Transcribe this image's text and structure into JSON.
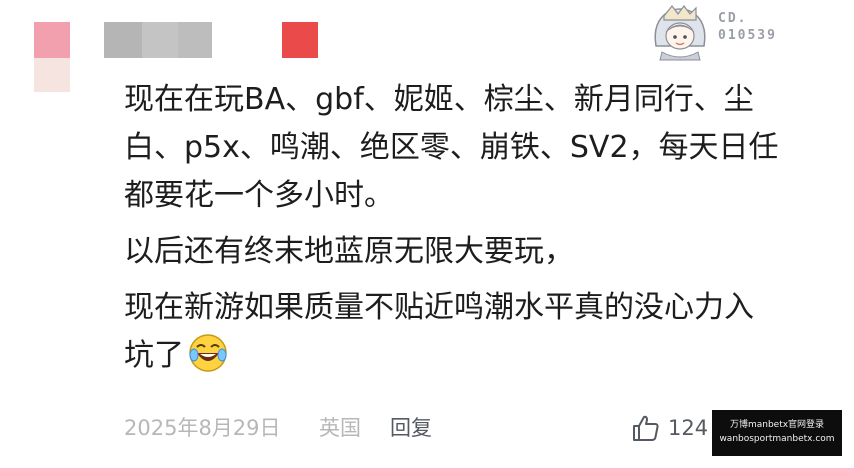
{
  "comment": {
    "lines": [
      "现在在玩BA、gbf、妮姬、棕尘、新月同行、尘",
      "白、p5x、鸣潮、绝区零、崩铁、SV2，每天日任",
      "都要花一个多小时。",
      "以后还有终末地蓝原无限大要玩，",
      "现在新游如果质量不贴近鸣潮水平真的没心力入",
      "坑了"
    ],
    "emoji": "laughing-with-tears"
  },
  "badge": {
    "code_line1": "CD.",
    "code_line2": "010539"
  },
  "footer": {
    "date": "2025年8月29日",
    "location": "英国",
    "reply_label": "回复",
    "like_count": "124"
  },
  "watermark": {
    "line1": "万博manbetx官网登录",
    "line2": "wanbosportmanbetx.com"
  },
  "colors": {
    "mosaic_pink": "#f2a0ae",
    "mosaic_red": "#ea4a4a",
    "meta_gray": "#b7b7b7",
    "text": "#1d1d1d"
  }
}
